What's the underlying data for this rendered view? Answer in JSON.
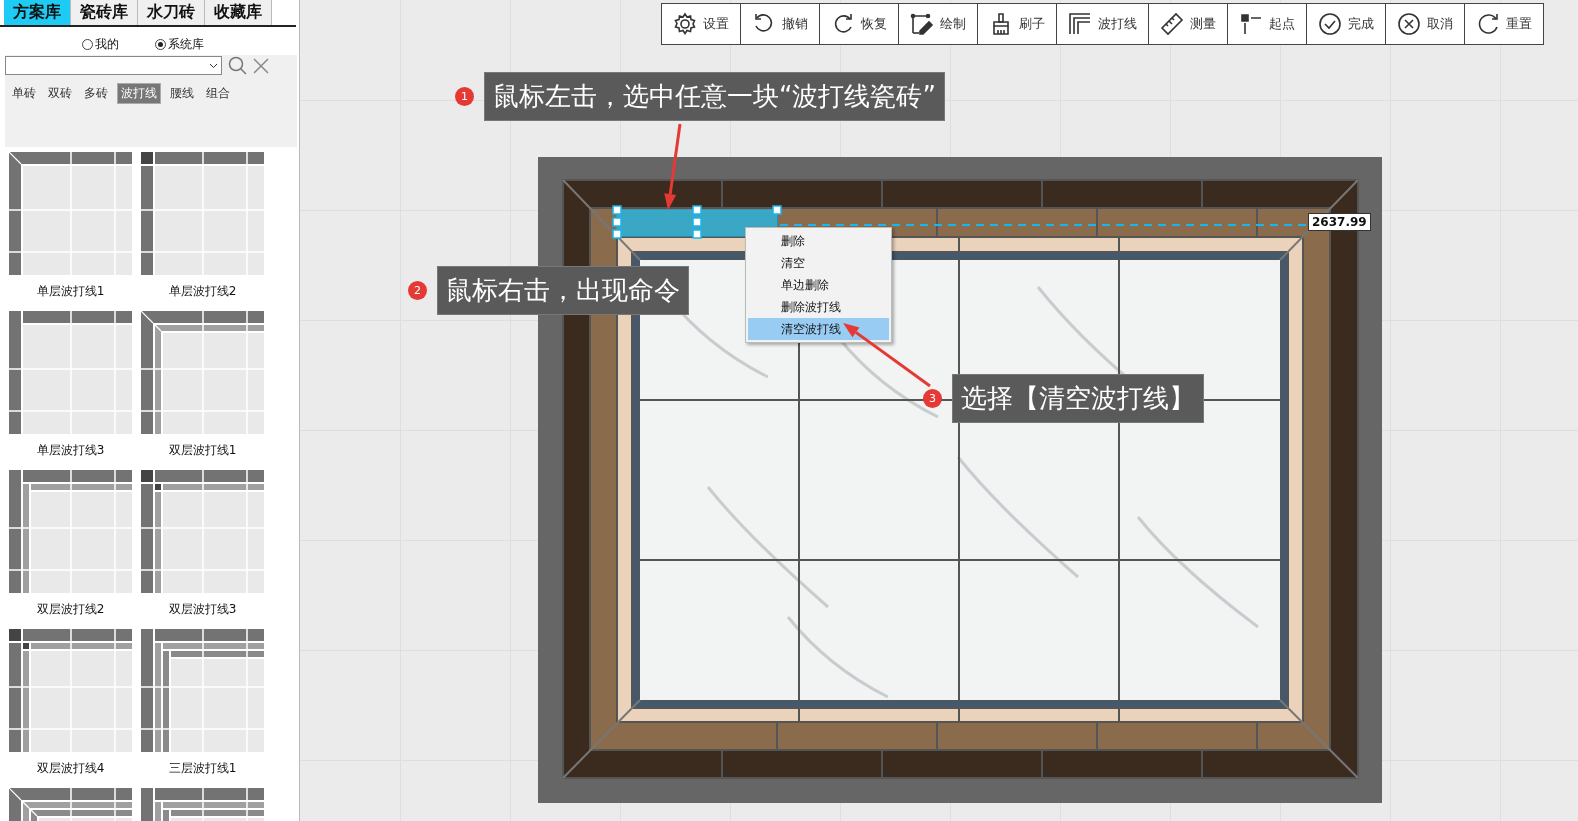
{
  "library_tabs": [
    {
      "label": "方案库",
      "selected": true
    },
    {
      "label": "瓷砖库",
      "selected": false
    },
    {
      "label": "水刀砖",
      "selected": false
    },
    {
      "label": "收藏库",
      "selected": false
    }
  ],
  "source_options": [
    {
      "label": "我的",
      "selected": false
    },
    {
      "label": "系统库",
      "selected": true
    }
  ],
  "categories": [
    {
      "label": "单砖",
      "selected": false
    },
    {
      "label": "双砖",
      "selected": false
    },
    {
      "label": "多砖",
      "selected": false
    },
    {
      "label": "波打线",
      "selected": true
    },
    {
      "label": "腰线",
      "selected": false
    },
    {
      "label": "组合",
      "selected": false
    }
  ],
  "patterns": [
    {
      "label": "单层波打线1",
      "kind": "single-miter"
    },
    {
      "label": "单层波打线2",
      "kind": "single-square"
    },
    {
      "label": "单层波打线3",
      "kind": "single-butt"
    },
    {
      "label": "双层波打线1",
      "kind": "double-miter"
    },
    {
      "label": "双层波打线2",
      "kind": "double-butt"
    },
    {
      "label": "双层波打线3",
      "kind": "double-square"
    },
    {
      "label": "双层波打线4",
      "kind": "double-square"
    },
    {
      "label": "三层波打线1",
      "kind": "triple-butt"
    },
    {
      "kind": "triple-miter"
    },
    {
      "kind": "triple-butt"
    }
  ],
  "toolbar": [
    {
      "label": "设置",
      "kind": "settings"
    },
    {
      "label": "撤销",
      "kind": "undo"
    },
    {
      "label": "恢复",
      "kind": "redo"
    },
    {
      "label": "绘制",
      "kind": "draw"
    },
    {
      "label": "刷子",
      "kind": "brush"
    },
    {
      "label": "波打线",
      "kind": "border"
    },
    {
      "label": "测量",
      "kind": "ruler"
    },
    {
      "label": "起点",
      "kind": "origin"
    },
    {
      "label": "完成",
      "kind": "done"
    },
    {
      "label": "取消",
      "kind": "cancel"
    },
    {
      "label": "重置",
      "kind": "reset"
    }
  ],
  "dimension": "2637.99",
  "context_menu": [
    {
      "label": "删除",
      "selected": false
    },
    {
      "label": "清空",
      "selected": false
    },
    {
      "label": "单边删除",
      "selected": false
    },
    {
      "label": "删除波打线",
      "selected": false
    },
    {
      "label": "清空波打线",
      "selected": true
    }
  ],
  "callouts": [
    {
      "number": "1",
      "text": "鼠标左击，选中任意一块“波打线瓷砖”"
    },
    {
      "number": "2",
      "text": "鼠标右击，出现命令"
    },
    {
      "number": "3",
      "text": "选择【清空波打线】"
    }
  ]
}
